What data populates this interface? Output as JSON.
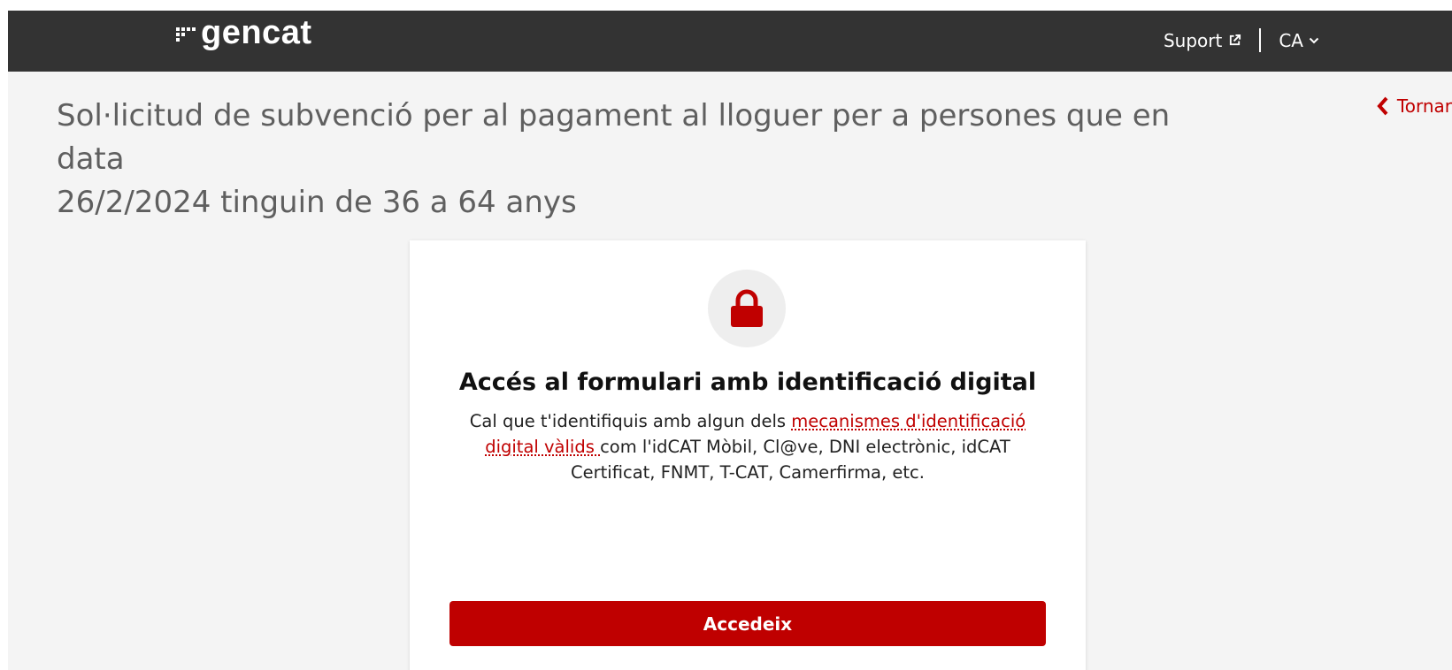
{
  "header": {
    "logo_text": "gencat",
    "support_label": "Suport",
    "language": "CA"
  },
  "main": {
    "title_line1": "Sol·licitud de subvenció per al pagament al lloguer per a persones que en data",
    "title_line2": "26/2/2024 tinguin de 36 a 64 anys",
    "back_label": "Tornar"
  },
  "card": {
    "heading": "Accés al formulari amb identificació digital",
    "text_before": "Cal que t'identifiquis amb algun dels ",
    "link_label": "mecanismes d'identificació digital vàlids ",
    "text_after": "com l'idCAT Mòbil, Cl@ve, DNI electrònic, idCAT Certificat, FNMT, T-CAT, Camerfirma, etc.",
    "button_label": "Accedeix"
  },
  "colors": {
    "topbar": "#333333",
    "accent": "#c00000",
    "background": "#f4f4f4"
  },
  "icons": [
    "gencat-logo-icon",
    "external-link-icon",
    "chevron-down-icon",
    "chevron-left-icon",
    "lock-icon"
  ]
}
